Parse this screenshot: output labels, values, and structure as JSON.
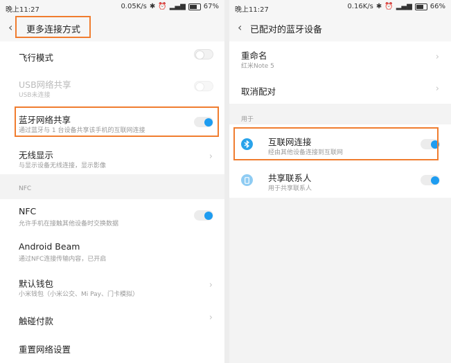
{
  "left": {
    "status": {
      "time": "晚上11:27",
      "speed": "0.05K/s",
      "battery": "67%"
    },
    "header": {
      "title": "更多连接方式"
    },
    "items": {
      "airplane": {
        "title": "飞行模式"
      },
      "usb": {
        "title": "USB网络共享",
        "subtitle": "USB未连接"
      },
      "bt_share": {
        "title": "蓝牙网络共享",
        "subtitle": "通过蓝牙与 1 台设备共享该手机的互联网连接"
      },
      "wireless": {
        "title": "无线显示",
        "subtitle": "与显示设备无线连接，显示影像"
      },
      "nfc_section": "NFC",
      "nfc": {
        "title": "NFC",
        "subtitle": "允许手机在接触其他设备时交换数据"
      },
      "beam": {
        "title": "Android Beam",
        "subtitle": "通过NFC连接传输内容，已开启"
      },
      "wallet": {
        "title": "默认钱包",
        "subtitle": "小米钱包（小米公交、Mi Pay、门卡模拟）"
      },
      "tap_pay": {
        "title": "触碰付款"
      },
      "reset": {
        "title": "重置网络设置"
      }
    }
  },
  "right": {
    "status": {
      "time": "晚上11:27",
      "speed": "0.16K/s",
      "battery": "66%"
    },
    "header": {
      "title": "已配对的蓝牙设备"
    },
    "items": {
      "rename": {
        "title": "重命名",
        "subtitle": "红米Note 5"
      },
      "unpair": {
        "title": "取消配对"
      },
      "section": "用于",
      "internet": {
        "title": "互联网连接",
        "subtitle": "经由其他设备连接到互联网"
      },
      "contacts": {
        "title": "共享联系人",
        "subtitle": "用于共享联系人"
      }
    }
  },
  "colors": {
    "accent": "#1e9cf0",
    "highlight": "#f07c2e"
  },
  "icons": [
    "back-chevron-icon",
    "bluetooth-icon",
    "alarm-icon",
    "signal-icon",
    "battery-icon",
    "chevron-right-icon",
    "phone-icon"
  ]
}
